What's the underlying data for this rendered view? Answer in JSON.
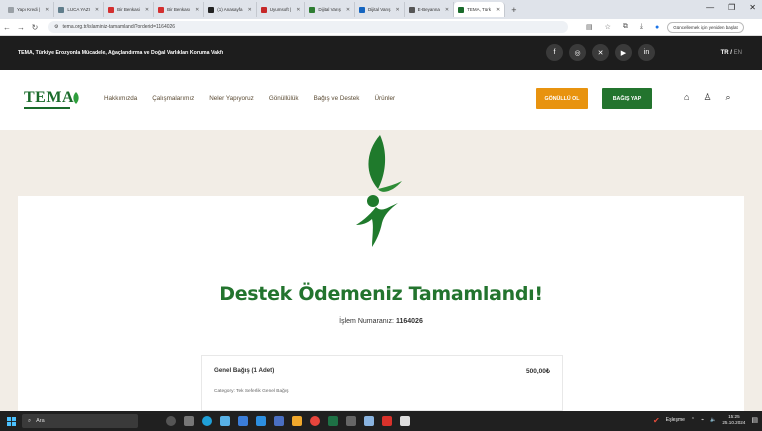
{
  "browser": {
    "tabs": [
      {
        "label": "Yapı Kredi |",
        "color": "#9aa0a6"
      },
      {
        "label": "LUCA YAZI",
        "color": "#607d8b"
      },
      {
        "label": "Bir Benkasi",
        "color": "#d32f2f"
      },
      {
        "label": "Bir Benkası",
        "color": "#d32f2f"
      },
      {
        "label": "(1) Anasayfa",
        "color": "#222222"
      },
      {
        "label": "Uyumsoft |",
        "color": "#c62828"
      },
      {
        "label": "Dijital Varış",
        "color": "#2e7d32"
      },
      {
        "label": "Dijital Varış",
        "color": "#1565c0"
      },
      {
        "label": "E-Beyanna",
        "color": "#555555"
      },
      {
        "label": "TEMA, Türk",
        "color": "#1a6b2b"
      }
    ],
    "url": "tema.org.tr/islaminiz-tamamlandi?orderid=1164026",
    "update_label": "Güncellemek için yeniden başlat"
  },
  "header": {
    "description": "TEMA, Türkiye Erozyonla Mücadele, Ağaçlandırma ve Doğal Varlıkları Koruma Vakfı",
    "lang_tr": "TR",
    "lang_sep": " / ",
    "lang_en": "EN"
  },
  "nav": {
    "logo": "TEMA",
    "items": [
      "Hakkımızda",
      "Çalışmalarımız",
      "Neler Yapıyoruz",
      "Gönüllülük",
      "Bağış ve Destek",
      "Ürünler"
    ],
    "volunteer_label": "GÖNÜLLÜ OL",
    "donate_label": "BAĞIŞ YAP"
  },
  "content": {
    "title": "Destek Ödemeniz Tamamlandı!",
    "txn_label": "İşlem Numaranız:",
    "txn_number": "1164026",
    "item_name": "Genel Bağış (1 Adet)",
    "item_amount": "500,00₺",
    "item_category": "Category: Tek Seferlik Genel Bağış"
  },
  "taskbar": {
    "search_placeholder": "Ara",
    "weather": "Eşleşme",
    "time": "15:25",
    "date": "25.10.2024"
  },
  "colors": {
    "green": "#23742e",
    "orange": "#e8930f",
    "dark": "#1d1d1d",
    "bg": "#f2ede6"
  }
}
